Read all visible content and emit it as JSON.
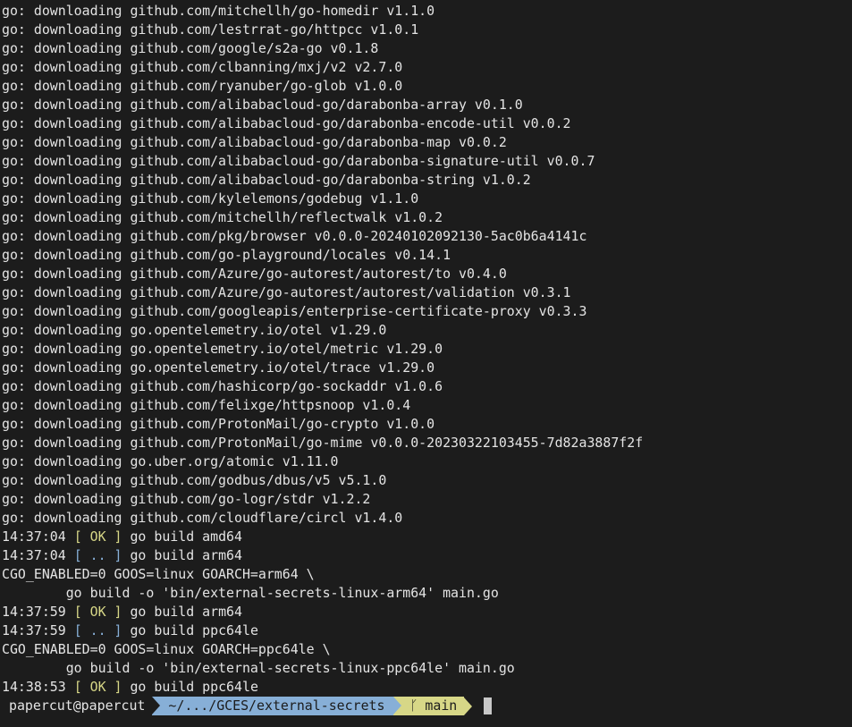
{
  "colors": {
    "background": "#1c1c1c",
    "foreground": "#e4e4e4",
    "ok": "#d7d787",
    "pending": "#87afd7",
    "path_segment": "#87afd7",
    "branch_segment": "#d7d787"
  },
  "download_lines": [
    "go: downloading github.com/mitchellh/go-homedir v1.1.0",
    "go: downloading github.com/lestrrat-go/httpcc v1.0.1",
    "go: downloading github.com/google/s2a-go v0.1.8",
    "go: downloading github.com/clbanning/mxj/v2 v2.7.0",
    "go: downloading github.com/ryanuber/go-glob v1.0.0",
    "go: downloading github.com/alibabacloud-go/darabonba-array v0.1.0",
    "go: downloading github.com/alibabacloud-go/darabonba-encode-util v0.0.2",
    "go: downloading github.com/alibabacloud-go/darabonba-map v0.0.2",
    "go: downloading github.com/alibabacloud-go/darabonba-signature-util v0.0.7",
    "go: downloading github.com/alibabacloud-go/darabonba-string v1.0.2",
    "go: downloading github.com/kylelemons/godebug v1.1.0",
    "go: downloading github.com/mitchellh/reflectwalk v1.0.2",
    "go: downloading github.com/pkg/browser v0.0.0-20240102092130-5ac0b6a4141c",
    "go: downloading github.com/go-playground/locales v0.14.1",
    "go: downloading github.com/Azure/go-autorest/autorest/to v0.4.0",
    "go: downloading github.com/Azure/go-autorest/autorest/validation v0.3.1",
    "go: downloading github.com/googleapis/enterprise-certificate-proxy v0.3.3",
    "go: downloading go.opentelemetry.io/otel v1.29.0",
    "go: downloading go.opentelemetry.io/otel/metric v1.29.0",
    "go: downloading go.opentelemetry.io/otel/trace v1.29.0",
    "go: downloading github.com/hashicorp/go-sockaddr v1.0.6",
    "go: downloading github.com/felixge/httpsnoop v1.0.4",
    "go: downloading github.com/ProtonMail/go-crypto v1.0.0",
    "go: downloading github.com/ProtonMail/go-mime v0.0.0-20230322103455-7d82a3887f2f",
    "go: downloading go.uber.org/atomic v1.11.0",
    "go: downloading github.com/godbus/dbus/v5 v5.1.0",
    "go: downloading github.com/go-logr/stdr v1.2.2",
    "go: downloading github.com/cloudflare/circl v1.4.0"
  ],
  "build_log": {
    "l1_time": "14:37:04",
    "l1_status": "[ OK ]",
    "l1_msg": "go build amd64",
    "l2_time": "14:37:04",
    "l2_status": "[ .. ]",
    "l2_msg": "go build arm64",
    "l3": "CGO_ENABLED=0 GOOS=linux GOARCH=arm64 \\",
    "l4": "        go build -o 'bin/external-secrets-linux-arm64' main.go",
    "l5_time": "14:37:59",
    "l5_status": "[ OK ]",
    "l5_msg": "go build arm64",
    "l6_time": "14:37:59",
    "l6_status": "[ .. ]",
    "l6_msg": "go build ppc64le",
    "l7": "CGO_ENABLED=0 GOOS=linux GOARCH=ppc64le \\",
    "l8": "        go build -o 'bin/external-secrets-linux-ppc64le' main.go",
    "l9_time": "14:38:53",
    "l9_status": "[ OK ]",
    "l9_msg": "go build ppc64le"
  },
  "prompt": {
    "user_host": "papercut@papercut",
    "path": "~/.../GCES/external-secrets",
    "branch_icon": "git-branch-icon",
    "branch_glyph": "ᚴ",
    "branch": "main"
  }
}
